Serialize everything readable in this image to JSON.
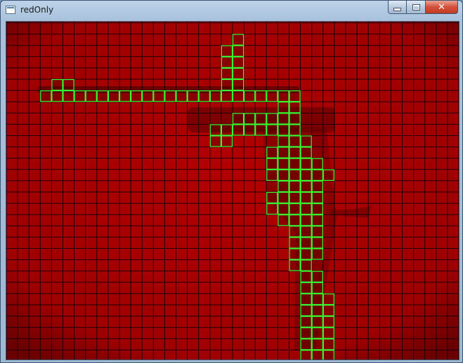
{
  "window": {
    "title": "redOnly",
    "controls": {
      "minimize_icon": "minimize-icon",
      "maximize_icon": "maximize-icon",
      "close_icon": "close-icon",
      "close_glyph": "✕"
    }
  },
  "image": {
    "background_color": "#b00000",
    "grid_color": "#1a0000",
    "highlight_color": "#33ff33",
    "cell_size_label": "16px grid",
    "columns": 40,
    "rows": 30,
    "highlighted_cells": [
      [
        20,
        1
      ],
      [
        19,
        2
      ],
      [
        20,
        2
      ],
      [
        19,
        3
      ],
      [
        20,
        3
      ],
      [
        19,
        4
      ],
      [
        20,
        4
      ],
      [
        19,
        5
      ],
      [
        20,
        5
      ],
      [
        4,
        5
      ],
      [
        5,
        5
      ],
      [
        19,
        6
      ],
      [
        20,
        6
      ],
      [
        3,
        6
      ],
      [
        4,
        6
      ],
      [
        5,
        6
      ],
      [
        6,
        6
      ],
      [
        7,
        6
      ],
      [
        8,
        6
      ],
      [
        9,
        6
      ],
      [
        10,
        6
      ],
      [
        11,
        6
      ],
      [
        12,
        6
      ],
      [
        13,
        6
      ],
      [
        14,
        6
      ],
      [
        15,
        6
      ],
      [
        16,
        6
      ],
      [
        17,
        6
      ],
      [
        18,
        6
      ],
      [
        19,
        6
      ],
      [
        20,
        6
      ],
      [
        21,
        6
      ],
      [
        22,
        6
      ],
      [
        23,
        6
      ],
      [
        24,
        6
      ],
      [
        25,
        6
      ],
      [
        24,
        7
      ],
      [
        25,
        7
      ],
      [
        24,
        8
      ],
      [
        25,
        8
      ],
      [
        20,
        8
      ],
      [
        21,
        8
      ],
      [
        22,
        8
      ],
      [
        23,
        8
      ],
      [
        20,
        9
      ],
      [
        21,
        9
      ],
      [
        22,
        9
      ],
      [
        23,
        9
      ],
      [
        24,
        9
      ],
      [
        25,
        9
      ],
      [
        18,
        9
      ],
      [
        19,
        9
      ],
      [
        18,
        10
      ],
      [
        19,
        10
      ],
      [
        24,
        10
      ],
      [
        25,
        10
      ],
      [
        26,
        10
      ],
      [
        23,
        11
      ],
      [
        24,
        11
      ],
      [
        25,
        11
      ],
      [
        26,
        11
      ],
      [
        23,
        12
      ],
      [
        24,
        12
      ],
      [
        25,
        12
      ],
      [
        26,
        12
      ],
      [
        27,
        12
      ],
      [
        23,
        13
      ],
      [
        24,
        13
      ],
      [
        25,
        13
      ],
      [
        26,
        13
      ],
      [
        27,
        13
      ],
      [
        28,
        13
      ],
      [
        24,
        14
      ],
      [
        25,
        14
      ],
      [
        26,
        14
      ],
      [
        27,
        14
      ],
      [
        23,
        15
      ],
      [
        24,
        15
      ],
      [
        25,
        15
      ],
      [
        26,
        15
      ],
      [
        27,
        15
      ],
      [
        23,
        16
      ],
      [
        24,
        16
      ],
      [
        25,
        16
      ],
      [
        26,
        16
      ],
      [
        27,
        16
      ],
      [
        24,
        17
      ],
      [
        25,
        17
      ],
      [
        26,
        17
      ],
      [
        27,
        17
      ],
      [
        25,
        18
      ],
      [
        26,
        18
      ],
      [
        27,
        18
      ],
      [
        25,
        19
      ],
      [
        26,
        19
      ],
      [
        27,
        19
      ],
      [
        25,
        20
      ],
      [
        26,
        20
      ],
      [
        27,
        20
      ],
      [
        25,
        21
      ],
      [
        26,
        21
      ],
      [
        26,
        22
      ],
      [
        27,
        22
      ],
      [
        26,
        23
      ],
      [
        27,
        23
      ],
      [
        26,
        24
      ],
      [
        27,
        24
      ],
      [
        28,
        24
      ],
      [
        26,
        25
      ],
      [
        27,
        25
      ],
      [
        28,
        25
      ],
      [
        26,
        26
      ],
      [
        27,
        26
      ],
      [
        28,
        26
      ],
      [
        26,
        27
      ],
      [
        27,
        27
      ],
      [
        28,
        27
      ],
      [
        26,
        28
      ],
      [
        27,
        28
      ],
      [
        28,
        28
      ],
      [
        26,
        29
      ],
      [
        27,
        29
      ],
      [
        28,
        29
      ]
    ]
  }
}
